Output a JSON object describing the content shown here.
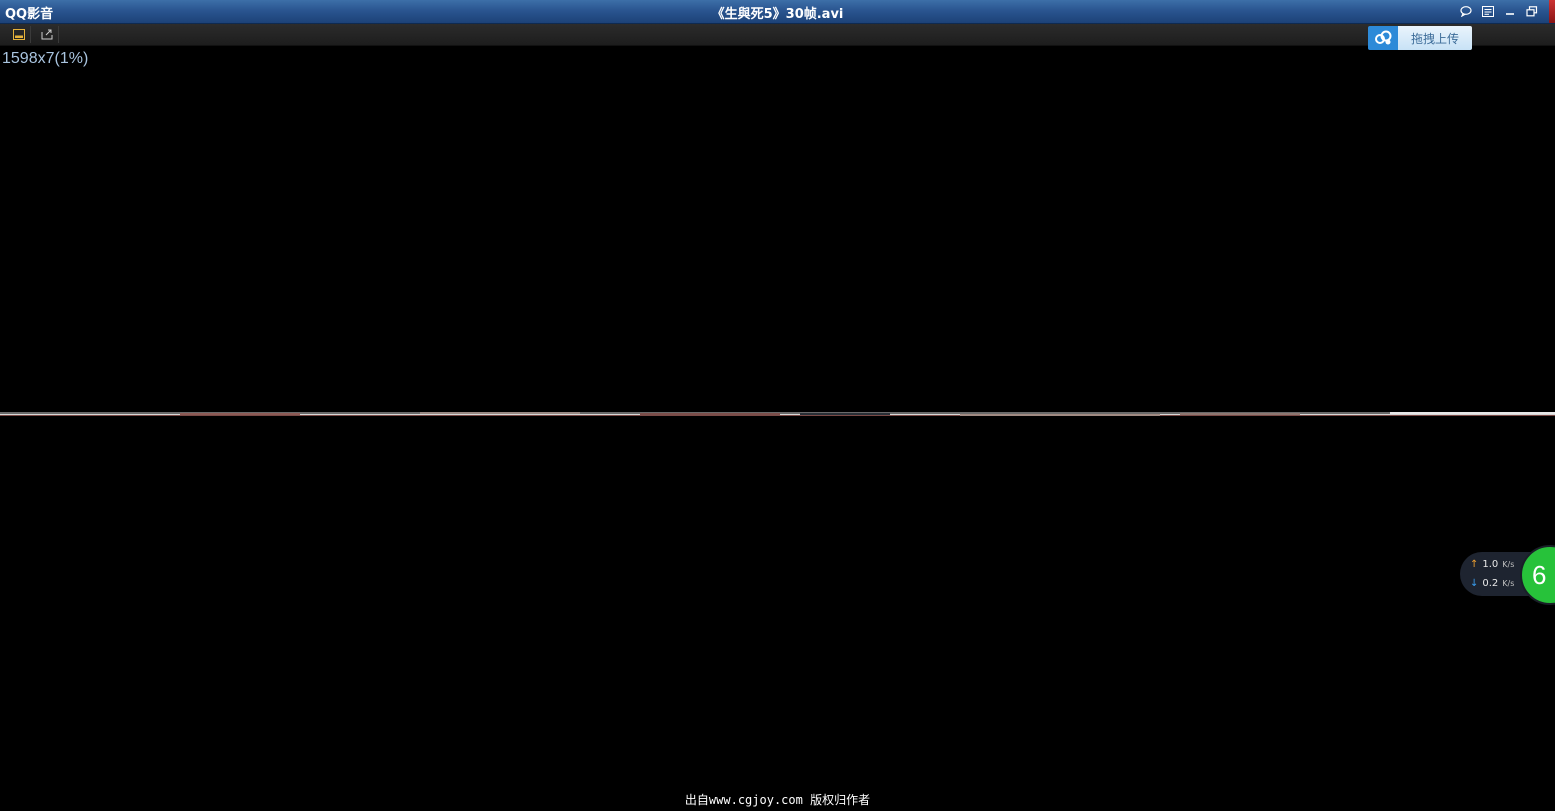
{
  "app": {
    "name": "QQ影音",
    "window_title": "《生與死5》30帧.avi"
  },
  "title_controls": {
    "chat": "chat-icon",
    "list": "playlist-icon",
    "minimize": "minimize-icon",
    "restore": "restore-icon"
  },
  "toolbar": {
    "buttons": [
      "subtitle-icon",
      "screenshot-icon"
    ]
  },
  "video": {
    "resolution_overlay": "1598x7(1%)"
  },
  "upload": {
    "label": "拖拽上传",
    "icon": "cloud-upload-icon"
  },
  "network": {
    "upload_speed": "1.0",
    "upload_unit": "K/s",
    "download_speed": "0.2",
    "download_unit": "K/s",
    "gauge_value": "6"
  },
  "footer": {
    "watermark": "出自www.cgjoy.com 版权归作者"
  },
  "colors": {
    "titlebar": "#2a5590",
    "upload_accent": "#2d8ad8",
    "gauge_green": "#27c23a"
  }
}
